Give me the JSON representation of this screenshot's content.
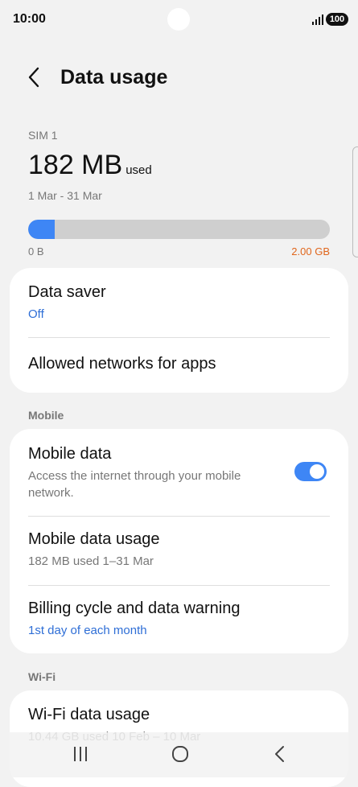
{
  "status_bar": {
    "time": "10:00",
    "battery": "100",
    "icons": [
      "signal-icon",
      "battery-icon"
    ]
  },
  "header": {
    "title": "Data usage",
    "back_icon": "chevron-left-icon"
  },
  "usage": {
    "sim_label": "SIM 1",
    "amount": "182 MB",
    "used_label": "used",
    "period": "1 Mar - 31 Mar",
    "bar_fill_fraction": 0.089,
    "min_label": "0 B",
    "max_label": "2.00 GB",
    "bar_color": "#3e86f5",
    "max_color": "#e0661c"
  },
  "saver_card": {
    "data_saver_title": "Data saver",
    "data_saver_status": "Off",
    "allowed_networks_title": "Allowed networks for apps"
  },
  "mobile_section": {
    "label": "Mobile",
    "mobile_data_title": "Mobile data",
    "mobile_data_subtitle": "Access the internet through your mobile network.",
    "mobile_data_on": true,
    "mobile_data_usage_title": "Mobile data usage",
    "mobile_data_usage_subtitle": "182 MB used 1–31 Mar",
    "billing_title": "Billing cycle and data warning",
    "billing_subtitle": "1st day of each month"
  },
  "wifi_section": {
    "label": "Wi-Fi",
    "wifi_usage_title": "Wi-Fi data usage",
    "wifi_usage_subtitle": "10.44 GB used 10 Feb – 10 Mar"
  },
  "nav_bar": {
    "icons": [
      "recent-apps-icon",
      "home-icon",
      "back-icon"
    ]
  },
  "colors": {
    "accent_blue": "#2e6ed6",
    "toggle_blue": "#3e86f5",
    "background": "#f2f2f2",
    "card": "#ffffff"
  }
}
